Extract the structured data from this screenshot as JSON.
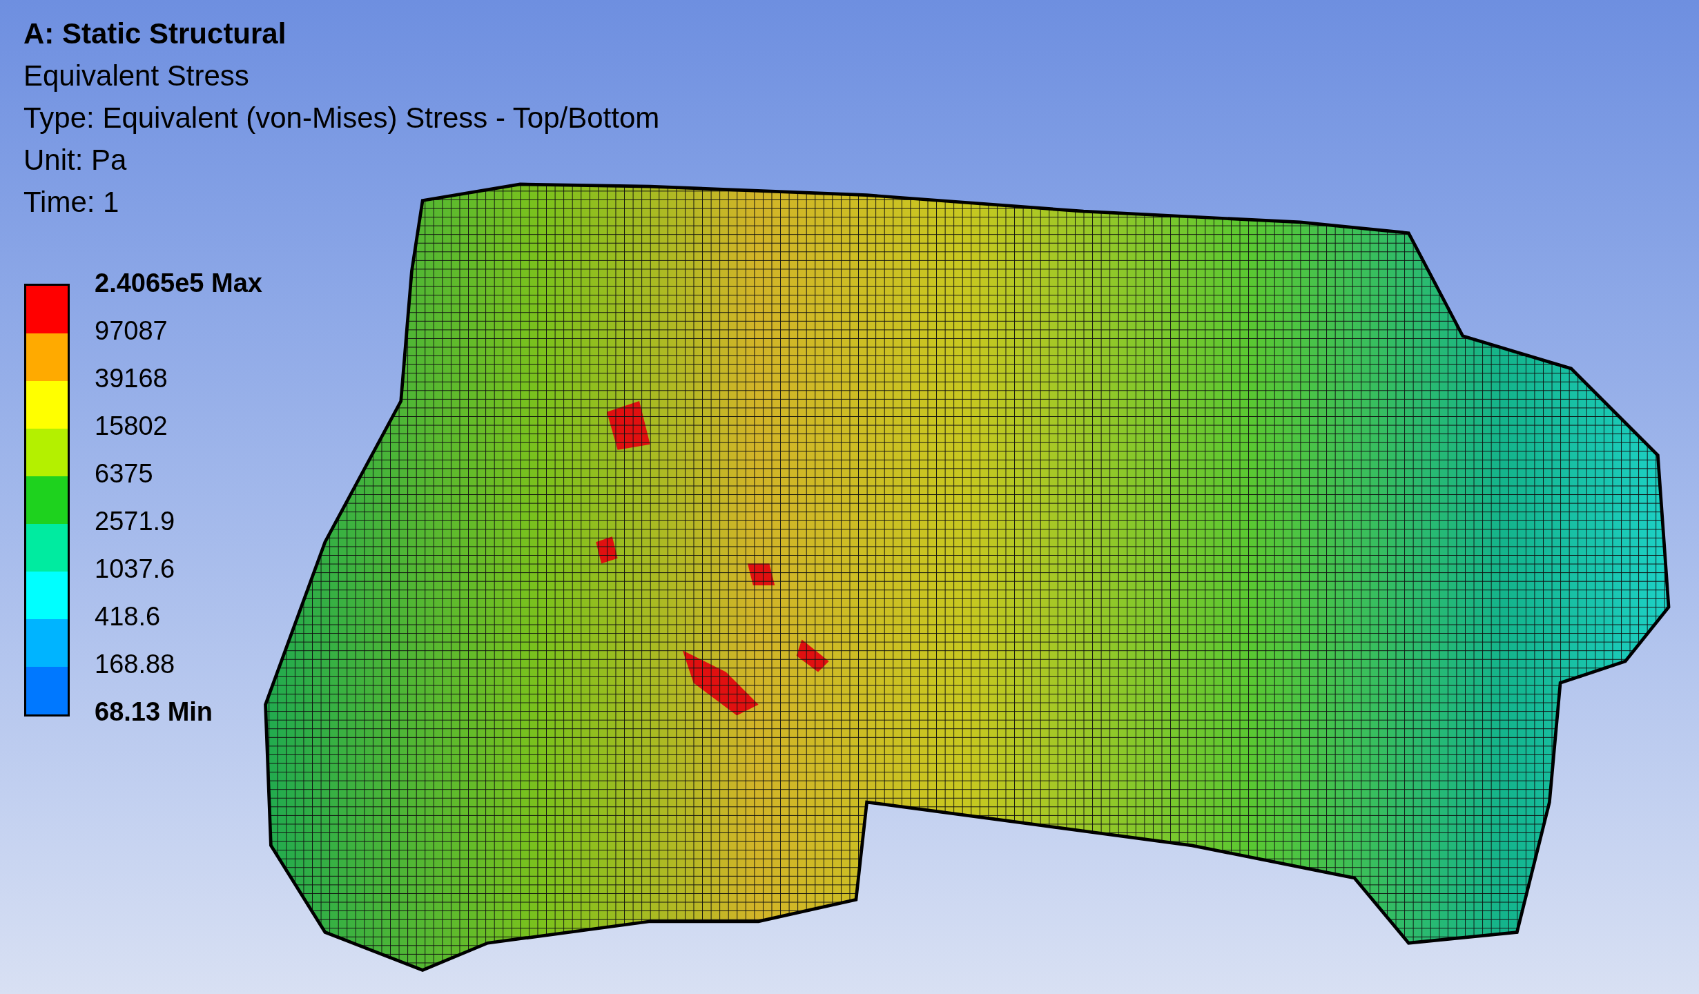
{
  "header": {
    "system": "A: Static Structural",
    "result": "Equivalent Stress",
    "type": "Type: Equivalent (von-Mises) Stress - Top/Bottom",
    "unit": "Unit: Pa",
    "time": "Time: 1"
  },
  "legend": {
    "max": "2.4065e5 Max",
    "min": "68.13 Min",
    "bands": [
      {
        "color": "#ff0000"
      },
      {
        "color": "#ffaa00"
      },
      {
        "color": "#ffff00"
      },
      {
        "color": "#b4f000"
      },
      {
        "color": "#1ed21e"
      },
      {
        "color": "#00eba0"
      },
      {
        "color": "#00ffff"
      },
      {
        "color": "#00b4ff"
      },
      {
        "color": "#0078ff"
      }
    ],
    "labels": [
      "97087",
      "39168",
      "15802",
      "6375",
      "2571.9",
      "1037.6",
      "418.6",
      "168.88"
    ]
  }
}
